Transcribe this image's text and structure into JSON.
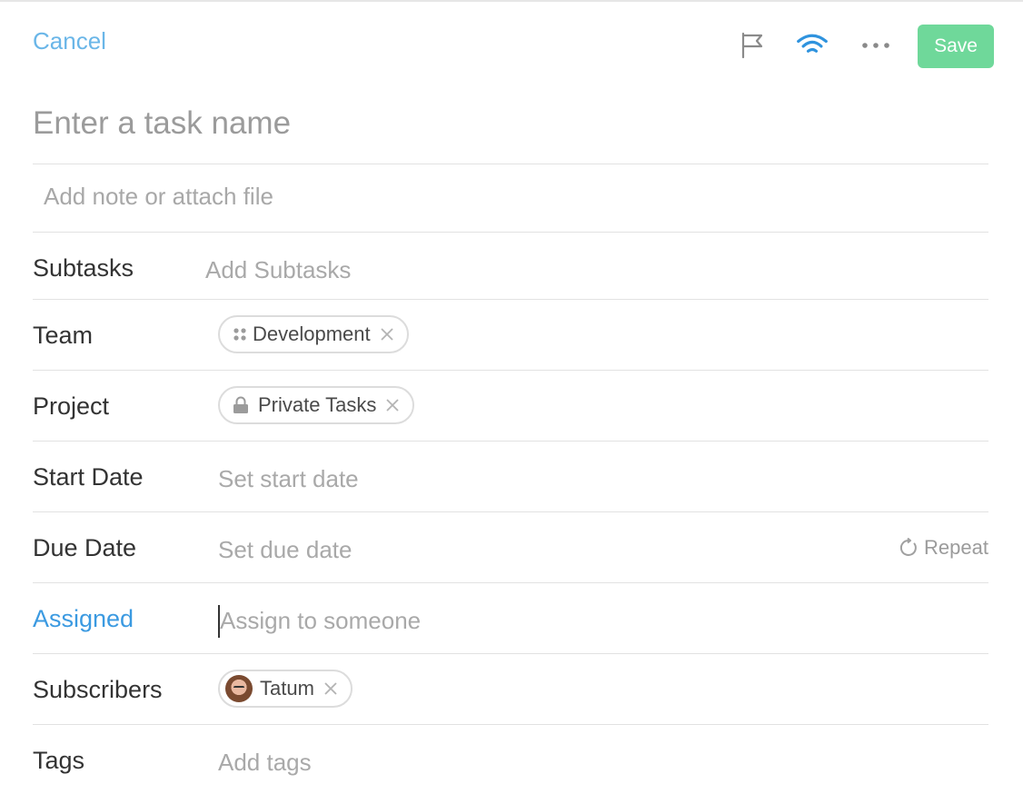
{
  "header": {
    "cancel_label": "Cancel",
    "save_label": "Save",
    "icons": [
      "flag-icon",
      "wifi-icon",
      "more-icon"
    ]
  },
  "task": {
    "name_placeholder": "Enter a task name",
    "note_placeholder": "Add note or attach file"
  },
  "fields": {
    "subtasks": {
      "label": "Subtasks",
      "placeholder": "Add Subtasks"
    },
    "team": {
      "label": "Team",
      "chip": "Development"
    },
    "project": {
      "label": "Project",
      "chip": "Private Tasks"
    },
    "start_date": {
      "label": "Start Date",
      "placeholder": "Set start date"
    },
    "due_date": {
      "label": "Due Date",
      "placeholder": "Set due date",
      "repeat_label": "Repeat"
    },
    "assigned": {
      "label": "Assigned",
      "placeholder": "Assign to someone"
    },
    "subscribers": {
      "label": "Subscribers",
      "chip": "Tatum"
    },
    "tags": {
      "label": "Tags",
      "placeholder": "Add tags"
    }
  },
  "colors": {
    "accent": "#3b9ae1",
    "cancel": "#6ab6e8",
    "save": "#6fd89a"
  }
}
